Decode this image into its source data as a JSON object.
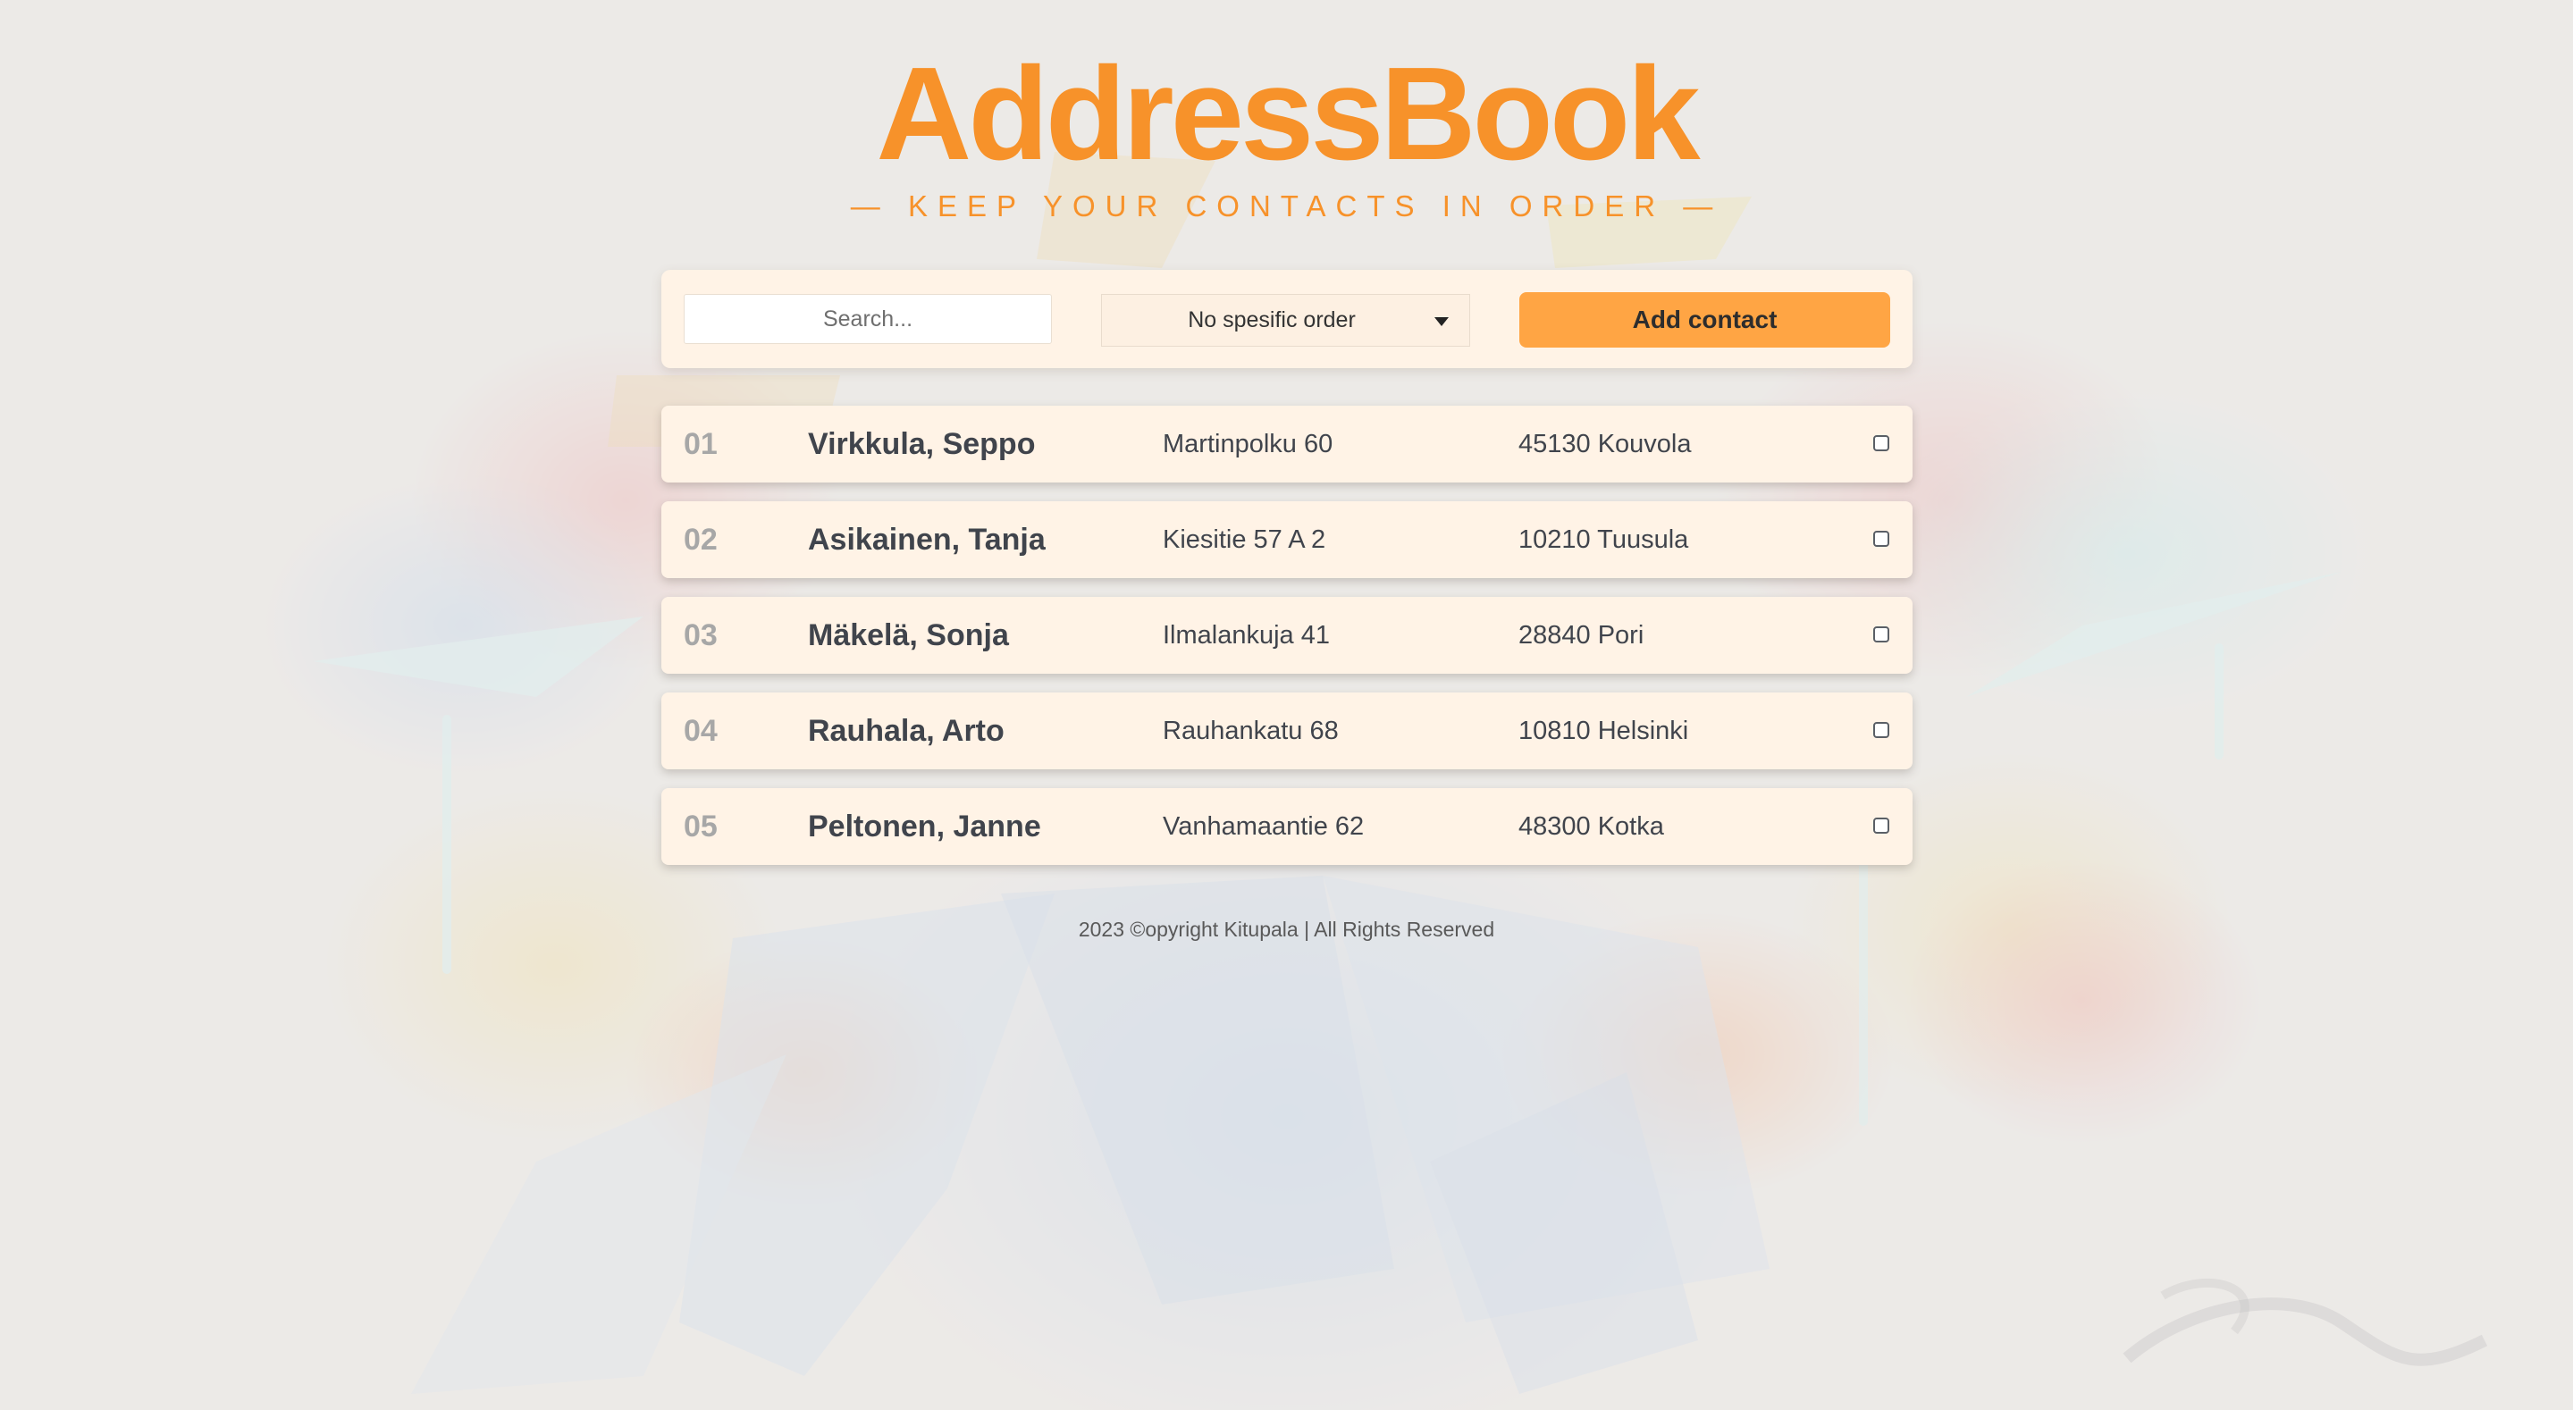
{
  "header": {
    "title": "AddressBook",
    "subtitle": "— KEEP YOUR CONTACTS IN ORDER —"
  },
  "toolbar": {
    "search_placeholder": "Search...",
    "search_value": "",
    "sort_selected": "No spesific order",
    "add_label": "Add contact"
  },
  "contacts": [
    {
      "num": "01",
      "name": "Virkkula, Seppo",
      "street": "Martinpolku 60",
      "city": "45130 Kouvola",
      "selected": false
    },
    {
      "num": "02",
      "name": "Asikainen, Tanja",
      "street": "Kiesitie 57 A 2",
      "city": "10210 Tuusula",
      "selected": false
    },
    {
      "num": "03",
      "name": "Mäkelä, Sonja",
      "street": "Ilmalankuja 41",
      "city": "28840 Pori",
      "selected": false
    },
    {
      "num": "04",
      "name": "Rauhala, Arto",
      "street": "Rauhankatu 68",
      "city": "10810 Helsinki",
      "selected": false
    },
    {
      "num": "05",
      "name": "Peltonen, Janne",
      "street": "Vanhamaantie 62",
      "city": "48300 Kotka",
      "selected": false
    }
  ],
  "footer": {
    "text": "2023 ©opyright Kitupala | All Rights Reserved"
  },
  "colors": {
    "accent": "#f7922a",
    "button": "#ffa544",
    "row_background": "#fff3e6",
    "page_background": "#eceae7"
  }
}
